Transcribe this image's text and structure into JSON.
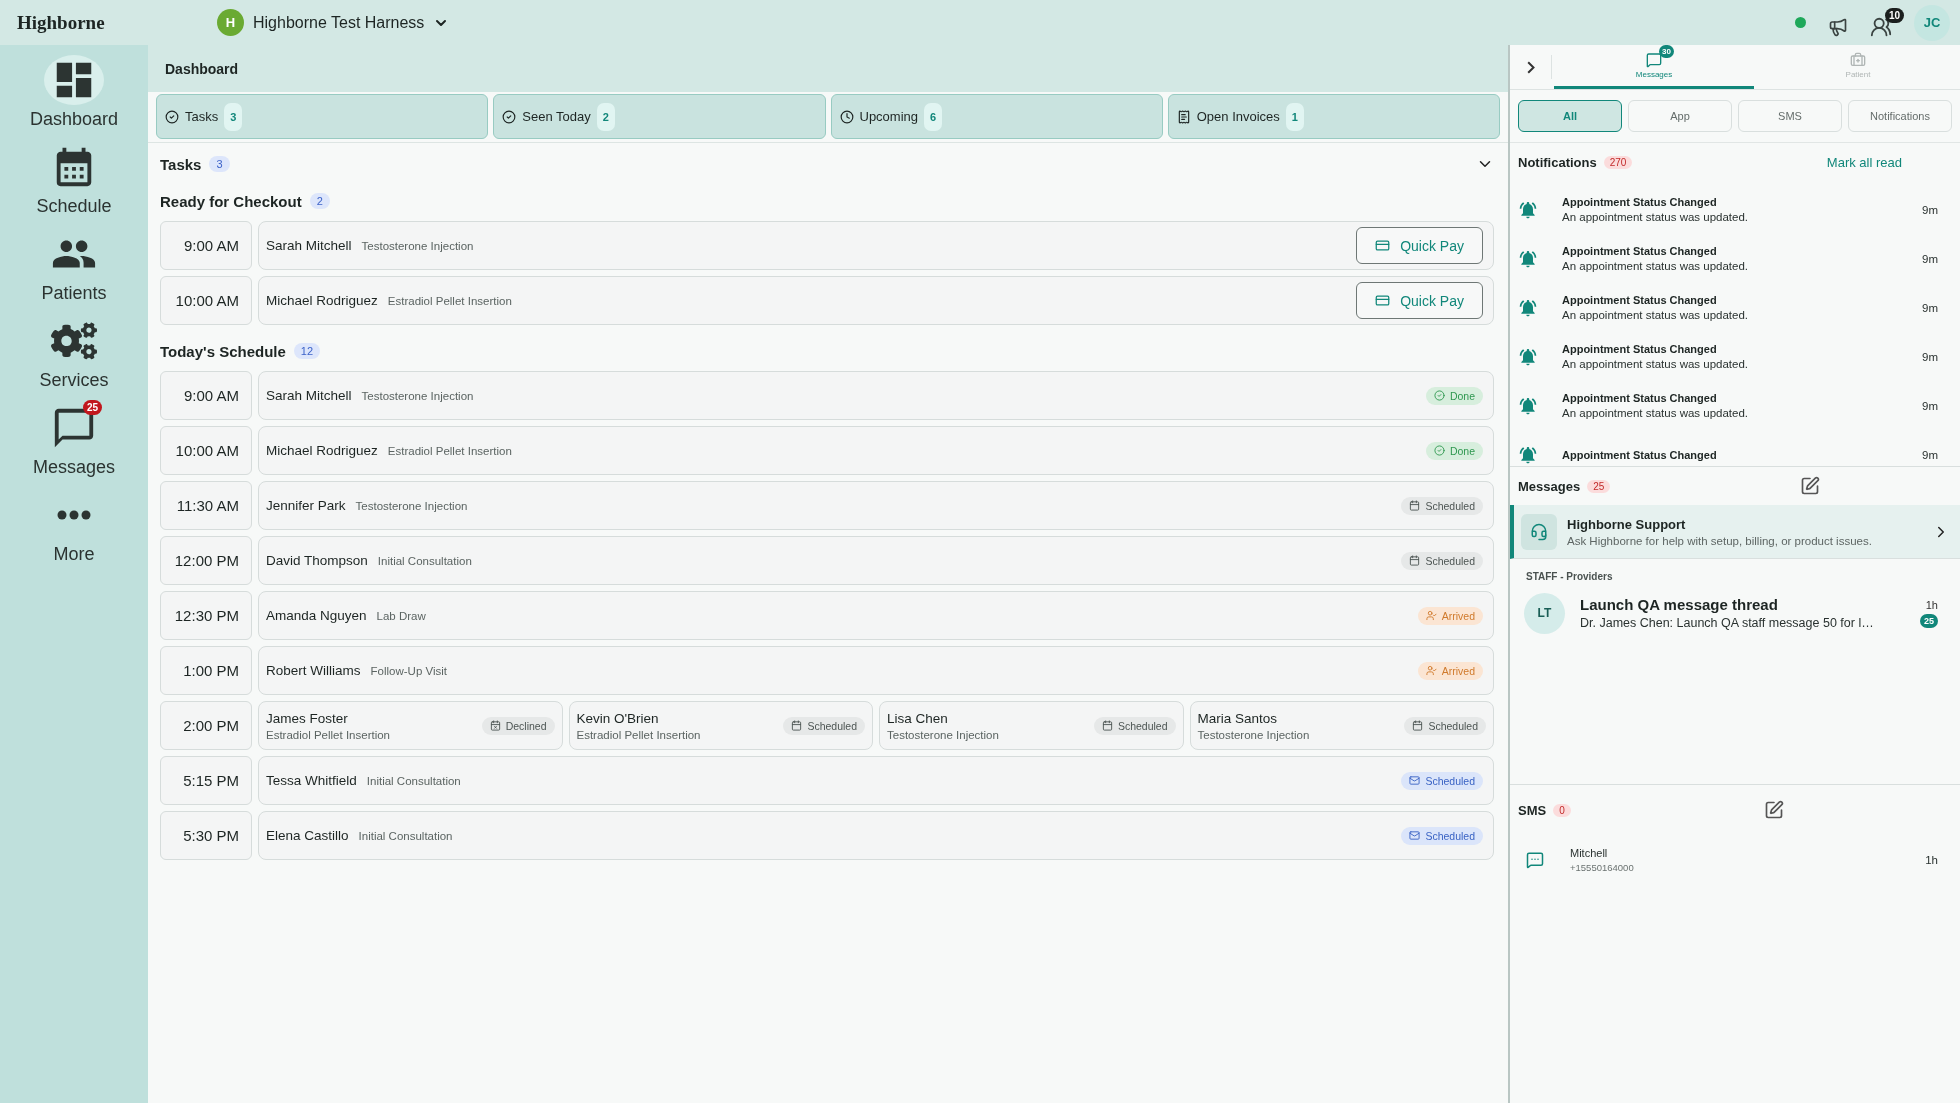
{
  "header": {
    "logo": "Highborne",
    "org": {
      "initial": "H",
      "name": "Highborne Test Harness"
    },
    "online": true,
    "contacts_badge": "10",
    "user_initials": "JC"
  },
  "sidebar": {
    "items": [
      {
        "label": "Dashboard",
        "selected": true
      },
      {
        "label": "Schedule",
        "selected": false
      },
      {
        "label": "Patients",
        "selected": false
      },
      {
        "label": "Services",
        "selected": false
      },
      {
        "label": "Messages",
        "selected": false,
        "badge": "25"
      },
      {
        "label": "More",
        "selected": false
      }
    ]
  },
  "page_title": "Dashboard",
  "summary_tabs": [
    {
      "label": "Tasks",
      "count": "3"
    },
    {
      "label": "Seen Today",
      "count": "2"
    },
    {
      "label": "Upcoming",
      "count": "6"
    },
    {
      "label": "Open Invoices",
      "count": "1"
    }
  ],
  "tasks": {
    "title": "Tasks",
    "count": "3",
    "expanded": true
  },
  "checkout": {
    "title": "Ready for Checkout",
    "count": "2",
    "rows": [
      {
        "time": "9:00 AM",
        "patient": "Sarah Mitchell",
        "service": "Testosterone Injection",
        "action": "Quick Pay"
      },
      {
        "time": "10:00 AM",
        "patient": "Michael Rodriguez",
        "service": "Estradiol Pellet Insertion",
        "action": "Quick Pay"
      }
    ]
  },
  "schedule": {
    "title": "Today's Schedule",
    "count": "12",
    "rows": [
      {
        "time": "9:00 AM",
        "appointments": [
          {
            "patient": "Sarah Mitchell",
            "service": "Testosterone Injection",
            "status": {
              "kind": "done",
              "label": "Done"
            }
          }
        ]
      },
      {
        "time": "10:00 AM",
        "appointments": [
          {
            "patient": "Michael Rodriguez",
            "service": "Estradiol Pellet Insertion",
            "status": {
              "kind": "done",
              "label": "Done"
            }
          }
        ]
      },
      {
        "time": "11:30 AM",
        "appointments": [
          {
            "patient": "Jennifer Park",
            "service": "Testosterone Injection",
            "status": {
              "kind": "scheduled",
              "label": "Scheduled"
            }
          }
        ]
      },
      {
        "time": "12:00 PM",
        "appointments": [
          {
            "patient": "David Thompson",
            "service": "Initial Consultation",
            "status": {
              "kind": "scheduled",
              "label": "Scheduled"
            }
          }
        ]
      },
      {
        "time": "12:30 PM",
        "appointments": [
          {
            "patient": "Amanda Nguyen",
            "service": "Lab Draw",
            "status": {
              "kind": "arrived",
              "label": "Arrived"
            }
          }
        ]
      },
      {
        "time": "1:00 PM",
        "appointments": [
          {
            "patient": "Robert Williams",
            "service": "Follow-Up Visit",
            "status": {
              "kind": "arrived",
              "label": "Arrived"
            }
          }
        ]
      },
      {
        "time": "2:00 PM",
        "appointments": [
          {
            "patient": "James Foster",
            "service": "Estradiol Pellet Insertion",
            "status": {
              "kind": "declined",
              "label": "Declined"
            }
          },
          {
            "patient": "Kevin O'Brien",
            "service": "Estradiol Pellet Insertion",
            "status": {
              "kind": "scheduled",
              "label": "Scheduled"
            }
          },
          {
            "patient": "Lisa Chen",
            "service": "Testosterone Injection",
            "status": {
              "kind": "scheduled",
              "label": "Scheduled"
            }
          },
          {
            "patient": "Maria Santos",
            "service": "Testosterone Injection",
            "status": {
              "kind": "scheduled",
              "label": "Scheduled"
            }
          }
        ]
      },
      {
        "time": "5:15 PM",
        "appointments": [
          {
            "patient": "Tessa Whitfield",
            "service": "Initial Consultation",
            "status": {
              "kind": "emailed",
              "label": "Scheduled"
            }
          }
        ]
      },
      {
        "time": "5:30 PM",
        "appointments": [
          {
            "patient": "Elena Castillo",
            "service": "Initial Consultation",
            "status": {
              "kind": "emailed",
              "label": "Scheduled"
            }
          }
        ]
      }
    ]
  },
  "panel": {
    "tabs": [
      {
        "label": "Messages",
        "badge": "30",
        "selected": true
      },
      {
        "label": "Patient",
        "selected": false
      }
    ],
    "filters": [
      {
        "label": "All",
        "selected": true
      },
      {
        "label": "App",
        "selected": false
      },
      {
        "label": "SMS",
        "selected": false
      },
      {
        "label": "Notifications",
        "selected": false
      }
    ],
    "notifications": {
      "title": "Notifications",
      "count": "270",
      "action": "Mark all read",
      "items": [
        {
          "title": "Appointment Status Changed",
          "body": "An appointment status was updated.",
          "time": "9m"
        },
        {
          "title": "Appointment Status Changed",
          "body": "An appointment status was updated.",
          "time": "9m"
        },
        {
          "title": "Appointment Status Changed",
          "body": "An appointment status was updated.",
          "time": "9m"
        },
        {
          "title": "Appointment Status Changed",
          "body": "An appointment status was updated.",
          "time": "9m"
        },
        {
          "title": "Appointment Status Changed",
          "body": "An appointment status was updated.",
          "time": "9m"
        },
        {
          "title": "Appointment Status Changed",
          "time": "9m"
        }
      ]
    },
    "messages": {
      "title": "Messages",
      "count": "25",
      "support": {
        "name": "Highborne Support",
        "description": "Ask Highborne for help with setup, billing, or product issues."
      },
      "group_label": "STAFF - Providers",
      "threads": [
        {
          "initials": "LT",
          "title": "Launch QA message thread",
          "preview": "Dr. James Chen: Launch QA staff message 50 for l…",
          "time": "1h",
          "unread": "25"
        }
      ]
    },
    "sms": {
      "title": "SMS",
      "count": "0",
      "items": [
        {
          "name": "Mitchell",
          "phone": "+15550164000",
          "time": "1h"
        }
      ]
    }
  }
}
